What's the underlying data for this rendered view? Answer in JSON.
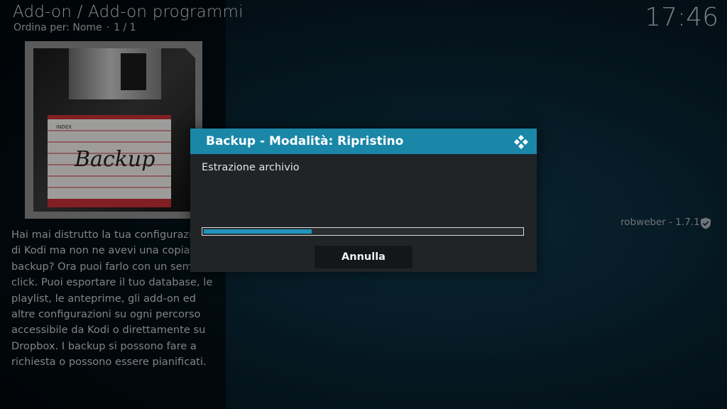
{
  "header": {
    "title": "Add-on / Add-on programmi",
    "sort_label": "Ordina per: Nome",
    "separator": "·",
    "page_count": "1 / 1"
  },
  "clock": {
    "time": "17:46"
  },
  "addon": {
    "art": {
      "index_label": "INDEX",
      "handwritten": "Backup"
    },
    "description": "Hai mai distrutto la tua configurazione di Kodi ma non ne avevi una copia di backup? Ora puoi farlo con un semplice click. Puoi esportare il tuo database, le playlist, le anteprime, gli add-on ed altre configurazioni su ogni percorso accessibile da Kodi o direttamente su Dropbox. I backup si possono fare a richiesta o possono essere pianificati.",
    "author_version": "robweber - 1.7.1"
  },
  "dialog": {
    "title": "Backup - Modalità: Ripristino",
    "message": "Estrazione archivio",
    "progress_percent": 34,
    "cancel_label": "Annulla"
  },
  "colors": {
    "accent": "#1a87a8",
    "progress": "#1f95bf",
    "dialog_bg": "#202427"
  },
  "icons": {
    "dialog_logo": "kodi-icon",
    "verified": "shield-check-icon"
  }
}
